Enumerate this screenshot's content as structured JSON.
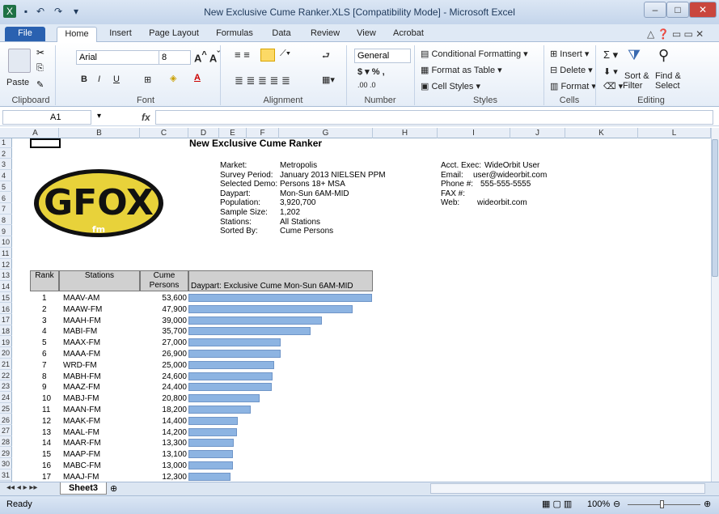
{
  "window": {
    "title": "New Exclusive Cume Ranker.XLS  [Compatibility Mode]  -  Microsoft Excel"
  },
  "tabs": [
    "File",
    "Home",
    "Insert",
    "Page Layout",
    "Formulas",
    "Data",
    "Review",
    "View",
    "Acrobat"
  ],
  "ribbon": {
    "paste": "Paste",
    "font_name": "Arial",
    "font_size": "8",
    "number_format": "General",
    "groups": [
      "Clipboard",
      "Font",
      "Alignment",
      "Number",
      "Styles",
      "Cells",
      "Editing"
    ],
    "styles": [
      "Conditional Formatting",
      "Format as Table",
      "Cell Styles"
    ],
    "cells": [
      "Insert",
      "Delete",
      "Format"
    ],
    "editing": {
      "sort": "Sort &",
      "sort2": "Filter",
      "find": "Find &",
      "find2": "Select"
    }
  },
  "formula_bar": {
    "name_box": "A1",
    "formula": ""
  },
  "columns": [
    "A",
    "B",
    "C",
    "D",
    "E",
    "F",
    "G",
    "H",
    "I",
    "J",
    "K",
    "L"
  ],
  "rows": [
    "1",
    "2",
    "3",
    "4",
    "5",
    "6",
    "7",
    "8",
    "9",
    "10",
    "11",
    "12",
    "13",
    "14",
    "15",
    "16",
    "17",
    "18",
    "19",
    "20",
    "21",
    "22",
    "23",
    "24",
    "25",
    "26",
    "27",
    "28",
    "29",
    "30",
    "31"
  ],
  "sheet": {
    "title": "New Exclusive Cume Ranker",
    "logo_text": "GFOX",
    "logo_sub": "fm",
    "info_labels": [
      "Market:",
      "Survey Period:",
      "Selected Demo:",
      "Daypart:",
      "Population:",
      "Sample Size:",
      "Stations:",
      "Sorted By:"
    ],
    "info_values": [
      "Metropolis",
      "January 2013 NIELSEN PPM",
      "Persons  18+ MSA",
      "Mon-Sun 6AM-MID",
      "3,920,700",
      "1,202",
      "All Stations",
      "Cume Persons"
    ],
    "contact_labels": [
      "Acct. Exec:",
      "Email:",
      "Phone #:",
      "FAX #:",
      "Web:"
    ],
    "contact_values": [
      "WideOrbit User",
      "user@wideorbit.com",
      "555-555-5555",
      "",
      "wideorbit.com"
    ],
    "hdr_rank": "Rank",
    "hdr_stations": "Stations",
    "hdr_cume1": "Cume",
    "hdr_cume2": "Persons",
    "hdr_daypart": "Daypart: Exclusive Cume Mon-Sun 6AM-MID",
    "table": [
      {
        "rank": "1",
        "station": "MAAV-AM",
        "cume": "53,600"
      },
      {
        "rank": "2",
        "station": "MAAW-FM",
        "cume": "47,900"
      },
      {
        "rank": "3",
        "station": "MAAH-FM",
        "cume": "39,000"
      },
      {
        "rank": "4",
        "station": "MABI-FM",
        "cume": "35,700"
      },
      {
        "rank": "5",
        "station": "MAAX-FM",
        "cume": "27,000"
      },
      {
        "rank": "6",
        "station": "MAAA-FM",
        "cume": "26,900"
      },
      {
        "rank": "7",
        "station": "WRD-FM",
        "cume": "25,000"
      },
      {
        "rank": "8",
        "station": "MABH-FM",
        "cume": "24,600"
      },
      {
        "rank": "9",
        "station": "MAAZ-FM",
        "cume": "24,400"
      },
      {
        "rank": "10",
        "station": "MABJ-FM",
        "cume": "20,800"
      },
      {
        "rank": "11",
        "station": "MAAN-FM",
        "cume": "18,200"
      },
      {
        "rank": "12",
        "station": "MAAK-FM",
        "cume": "14,400"
      },
      {
        "rank": "13",
        "station": "MAAL-FM",
        "cume": "14,200"
      },
      {
        "rank": "14",
        "station": "MAAR-FM",
        "cume": "13,300"
      },
      {
        "rank": "15",
        "station": "MAAP-FM",
        "cume": "13,100"
      },
      {
        "rank": "16",
        "station": "MABC-FM",
        "cume": "13,000"
      },
      {
        "rank": "17",
        "station": "MAAJ-FM",
        "cume": "12,300"
      }
    ]
  },
  "sheet_tab": "Sheet3",
  "status": {
    "ready": "Ready",
    "zoom": "100%"
  },
  "colors": {
    "bar": "#8db4e2",
    "file_tab": "#2a61b0"
  }
}
